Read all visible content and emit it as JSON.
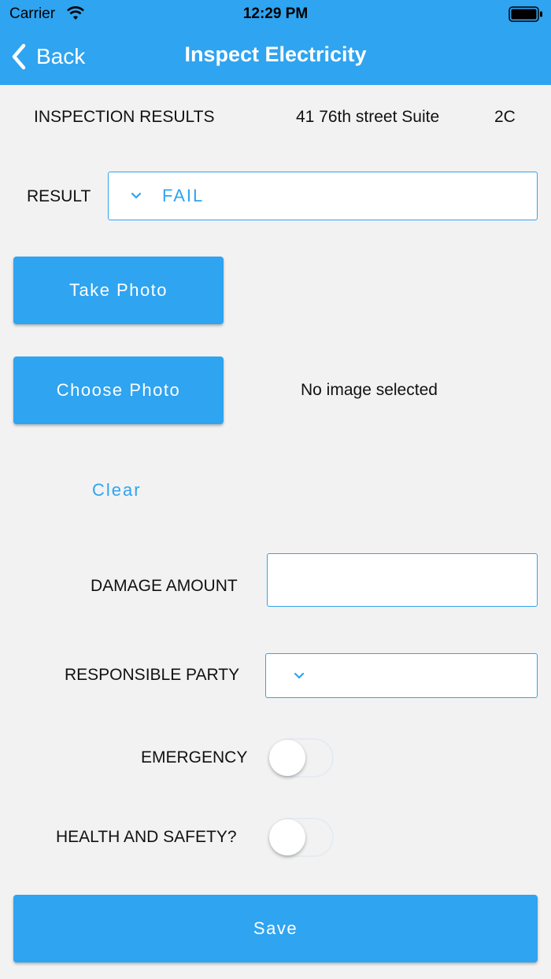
{
  "status_bar": {
    "carrier": "Carrier",
    "time": "12:29 PM"
  },
  "nav": {
    "back_label": "Back",
    "title": "Inspect Electricity"
  },
  "summary": {
    "heading": "INSPECTION RESULTS",
    "address": "41 76th street Suite",
    "unit": "2C"
  },
  "result": {
    "label": "RESULT",
    "value": "FAIL"
  },
  "photo": {
    "take_label": "Take Photo",
    "choose_label": "Choose Photo",
    "status": "No image selected",
    "clear_label": "Clear"
  },
  "damage": {
    "label": "DAMAGE AMOUNT",
    "value": ""
  },
  "responsible": {
    "label": "RESPONSIBLE PARTY",
    "value": ""
  },
  "emergency": {
    "label": "EMERGENCY",
    "on": false
  },
  "health": {
    "label": "HEALTH AND SAFETY?",
    "on": false
  },
  "save_label": "Save",
  "colors": {
    "accent": "#2fa4f0",
    "background": "#f2f2f2"
  }
}
